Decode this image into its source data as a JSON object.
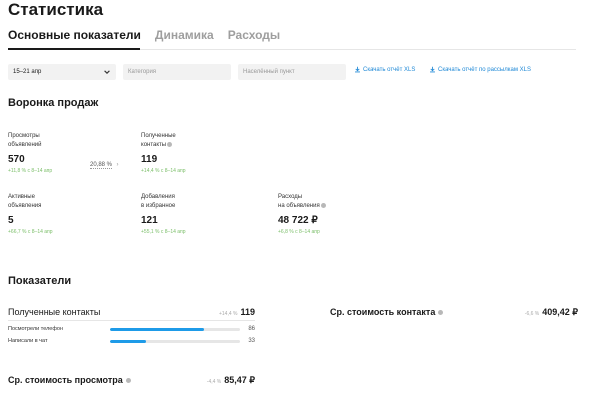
{
  "page": {
    "title": "Статистика"
  },
  "tabs": [
    {
      "label": "Основные показатели",
      "active": true
    },
    {
      "label": "Динамика",
      "active": false
    },
    {
      "label": "Расходы",
      "active": false
    }
  ],
  "filters": {
    "period": "15–21 апр",
    "category_placeholder": "Категория",
    "city_placeholder": "Населённый пункт",
    "download_report": "Скачать отчёт XLS",
    "download_mailing": "Скачать отчёт по рассылкам XLS"
  },
  "funnel": {
    "title": "Воронка продаж",
    "conversion": "20,88 %",
    "metrics": [
      {
        "label_1": "Просмотры",
        "label_2": "объявлений",
        "value": "570",
        "delta": "+11,8 % с 8–14 апр",
        "info": false
      },
      {
        "label_1": "Полученные",
        "label_2": "контакты",
        "value": "119",
        "delta": "+14,4 % с 8–14 апр",
        "info": true
      },
      {
        "label_1": "Активные",
        "label_2": "объявления",
        "value": "5",
        "delta": "+66,7 % с 8–14 апр",
        "info": false
      },
      {
        "label_1": "Добавления",
        "label_2": "в избранное",
        "value": "121",
        "delta": "+55,1 % с 8–14 апр",
        "info": false
      },
      {
        "label_1": "Расходы",
        "label_2": "на объявления",
        "value": "48 722 ₽",
        "delta": "+6,8 % с 8–14 апр",
        "info": true
      }
    ]
  },
  "indicators": {
    "title": "Показатели",
    "contacts": {
      "title": "Полученные контакты",
      "delta": "+14,4 %",
      "value": "119",
      "rows": [
        {
          "label": "Посмотрели телефон",
          "value": "86",
          "fraction": 0.72
        },
        {
          "label": "Написали в чат",
          "value": "33",
          "fraction": 0.28
        }
      ]
    },
    "contact_cost": {
      "title": "Ср. стоимость контакта",
      "delta": "-6,6 %",
      "value": "409,42 ₽"
    },
    "view_cost": {
      "title": "Ср. стоимость просмотра",
      "delta": "-4,4 %",
      "value": "85,47 ₽"
    }
  },
  "colors": {
    "accent": "#1e9be8",
    "link": "#1e88d6",
    "positive": "#7cbf6a",
    "muted": "#9e9e9e"
  },
  "icons": {
    "chevron": "chevron-down-icon",
    "download": "download-icon",
    "info": "info-icon"
  }
}
